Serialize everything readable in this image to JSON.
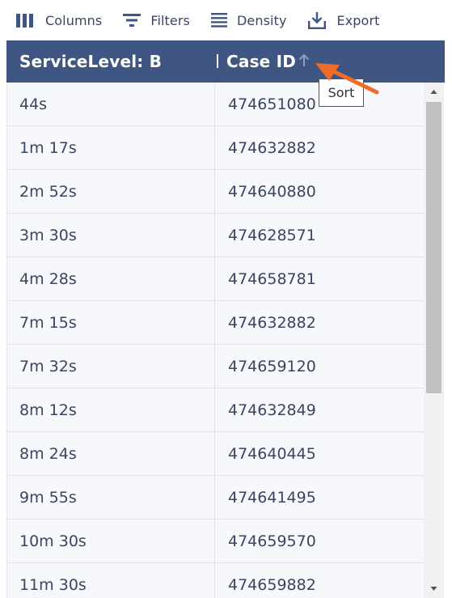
{
  "toolbar": {
    "columns_label": "Columns",
    "filters_label": "Filters",
    "density_label": "Density",
    "export_label": "Export"
  },
  "header": {
    "col1": "ServiceLevel: B",
    "col2": "Case ID"
  },
  "tooltip": {
    "text": "Sort"
  },
  "colors": {
    "header_bg": "#3f5683",
    "arrow": "#f06a28",
    "text": "#3a4560"
  },
  "rows": [
    {
      "service_level": "44s",
      "case_id": "474651080"
    },
    {
      "service_level": "1m 17s",
      "case_id": "474632882"
    },
    {
      "service_level": "2m 52s",
      "case_id": "474640880"
    },
    {
      "service_level": "3m 30s",
      "case_id": "474628571"
    },
    {
      "service_level": "4m 28s",
      "case_id": "474658781"
    },
    {
      "service_level": "7m 15s",
      "case_id": "474632882"
    },
    {
      "service_level": "7m 32s",
      "case_id": "474659120"
    },
    {
      "service_level": "8m 12s",
      "case_id": "474632849"
    },
    {
      "service_level": "8m 24s",
      "case_id": "474640445"
    },
    {
      "service_level": "9m 55s",
      "case_id": "474641495"
    },
    {
      "service_level": "10m 30s",
      "case_id": "474659570"
    },
    {
      "service_level": "11m 30s",
      "case_id": "474659882"
    }
  ]
}
